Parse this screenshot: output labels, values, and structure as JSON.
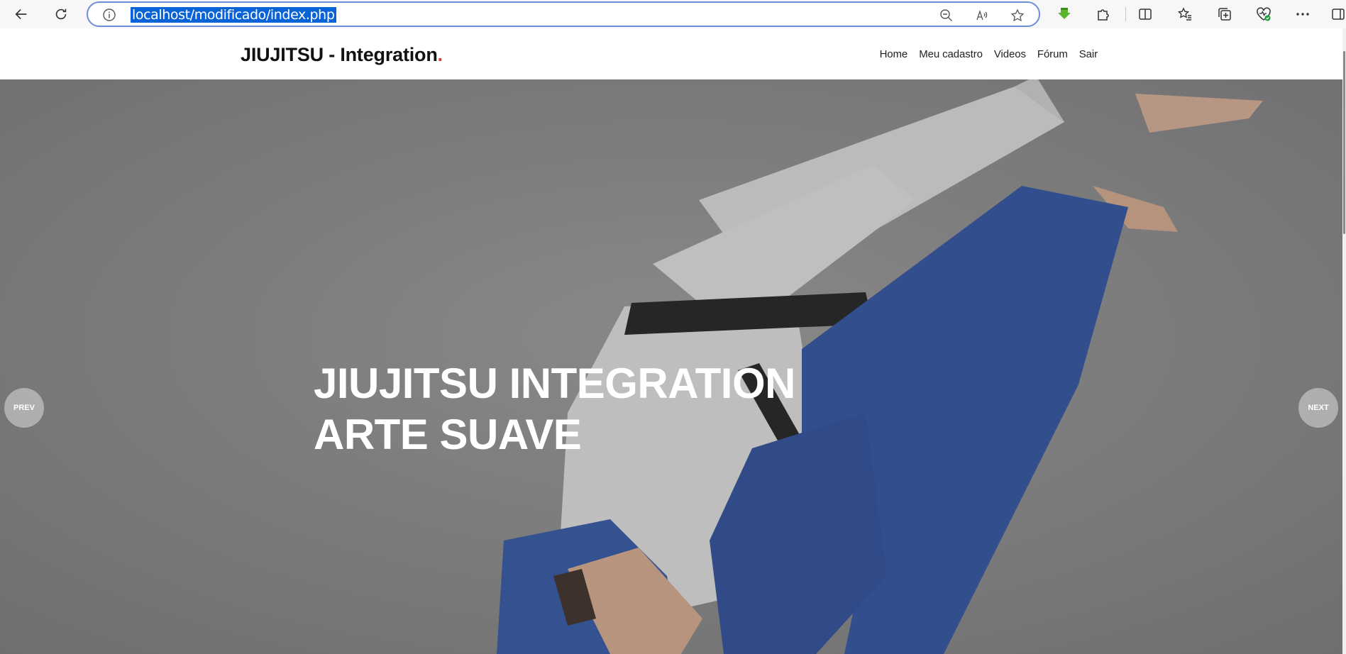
{
  "browser": {
    "url": "localhost/modificado/index.php",
    "accent_color": "#0a63d6"
  },
  "site": {
    "brand_text": "JIUJITSU - Integration",
    "brand_dot": ".",
    "nav": [
      "Home",
      "Meu cadastro",
      "Videos",
      "Fórum",
      "Sair"
    ]
  },
  "hero": {
    "title_line1": "JIUJITSU INTEGRATION",
    "title_line2": "ARTE SUAVE",
    "prev_label": "PREV",
    "next_label": "NEXT"
  },
  "icons": {
    "back": "arrow-left-icon",
    "refresh": "refresh-icon",
    "info": "info-icon",
    "zoom": "zoom-out-icon",
    "read_aloud": "read-aloud-icon",
    "favorite": "star-icon",
    "extensions": "puzzle-icon"
  }
}
